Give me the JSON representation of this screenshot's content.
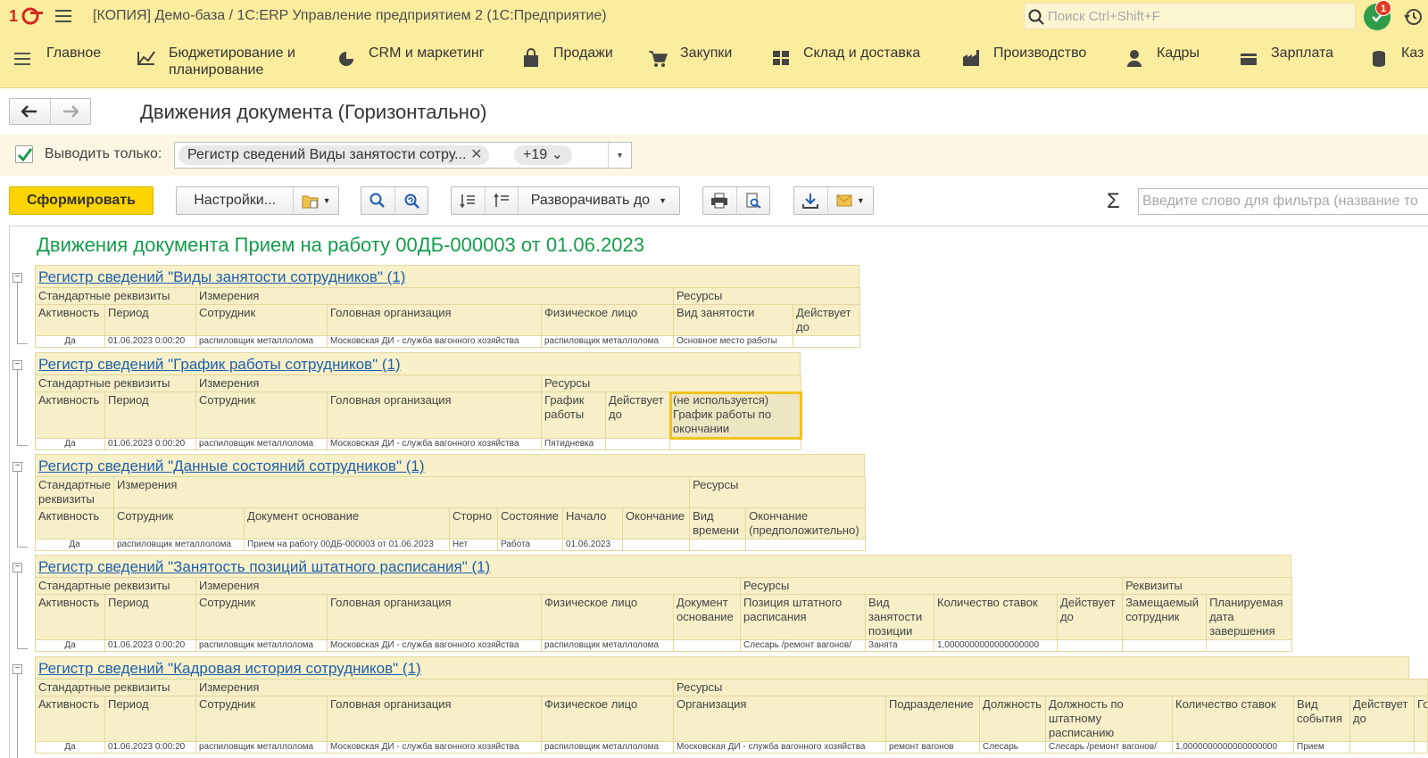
{
  "titlebar": {
    "title": "[КОПИЯ] Демо-база / 1С:ERP Управление предприятием 2  (1С:Предприятие)",
    "search_placeholder": "Поиск Ctrl+Shift+F",
    "notifications_count": "1"
  },
  "sections": [
    {
      "label": "Главное",
      "icon": "menu-icon"
    },
    {
      "label": "Бюджетирование и планирование",
      "icon": "budget-icon"
    },
    {
      "label": "CRM и маркетинг",
      "icon": "pie-chart-icon"
    },
    {
      "label": "Продажи",
      "icon": "shopping-bag-icon"
    },
    {
      "label": "Закупки",
      "icon": "cart-icon"
    },
    {
      "label": "Склад и доставка",
      "icon": "warehouse-icon"
    },
    {
      "label": "Производство",
      "icon": "factory-icon"
    },
    {
      "label": "Кадры",
      "icon": "person-icon"
    },
    {
      "label": "Зарплата",
      "icon": "wallet-icon"
    },
    {
      "label": "Каз",
      "icon": "coins-icon"
    }
  ],
  "form": {
    "title": "Движения документа (Горизонтально)",
    "filter_label": "Выводить только:",
    "filter_chip": "Регистр сведений Виды занятости сотру...",
    "filter_more": "+19",
    "generate_button": "Сформировать",
    "settings_button": "Настройки...",
    "expand_button": "Разворачивать до",
    "text_filter_placeholder": "Введите слово для фильтра (название то"
  },
  "report": {
    "title": "Движения документа Прием на работу 00ДБ-000003 от 01.06.2023",
    "blocks": [
      {
        "title": "Регистр сведений \"Виды занятости сотрудников\" (1)",
        "groups": [
          "Стандартные реквизиты",
          "Измерения",
          "Ресурсы"
        ],
        "columns": [
          "Активность",
          "Период",
          "Сотрудник",
          "Головная организация",
          "Физическое лицо",
          "Вид занятости",
          "Действует до"
        ],
        "row": [
          "Да",
          "01.06.2023 0:00:20",
          "распиловщик металлолома",
          "Московская ДИ - служба вагонного хозяйства",
          "распиловщик металлолома",
          "Основное место работы",
          ""
        ]
      },
      {
        "title": "Регистр сведений \"График работы сотрудников\" (1)",
        "groups": [
          "Стандартные реквизиты",
          "Измерения",
          "Ресурсы"
        ],
        "columns": [
          "Активность",
          "Период",
          "Сотрудник",
          "Головная организация",
          "График работы",
          "Действует до",
          "(не используется) График работы по окончании"
        ],
        "row": [
          "Да",
          "01.06.2023 0:00:20",
          "распиловщик металлолома",
          "Московская ДИ - служба вагонного хозяйства",
          "Пятидневка",
          "",
          ""
        ]
      },
      {
        "title": "Регистр сведений \"Данные состояний сотрудников\" (1)",
        "groups": [
          "Стандартные реквизиты",
          "Измерения",
          "Ресурсы"
        ],
        "columns": [
          "Активность",
          "Сотрудник",
          "Документ основание",
          "Сторно",
          "Состояние",
          "Начало",
          "Окончание",
          "Вид времени",
          "Окончание (предположительно)"
        ],
        "row": [
          "Да",
          "распиловщик металлолома",
          "Прием на работу 00ДБ-000003 от 01.06.2023",
          "Нет",
          "Работа",
          "01.06.2023",
          "",
          "",
          ""
        ]
      },
      {
        "title": "Регистр сведений \"Занятость позиций штатного расписания\" (1)",
        "groups": [
          "Стандартные реквизиты",
          "Измерения",
          "Ресурсы",
          "Реквизиты"
        ],
        "columns": [
          "Активность",
          "Период",
          "Сотрудник",
          "Головная организация",
          "Физическое лицо",
          "Документ основание",
          "Позиция штатного расписания",
          "Вид занятости позиции",
          "Количество ставок",
          "Действует до",
          "Замещаемый сотрудник",
          "Планируемая дата завершения"
        ],
        "row": [
          "Да",
          "01.06.2023 0:00:20",
          "распиловщик металлолома",
          "Московская ДИ - служба вагонного хозяйства",
          "распиловщик металлолома",
          "",
          "Слесарь /ремонт вагонов/",
          "Занята",
          "1,0000000000000000000",
          "",
          "",
          ""
        ]
      },
      {
        "title": "Регистр сведений \"Кадровая история сотрудников\" (1)",
        "groups": [
          "Стандартные реквизиты",
          "Измерения",
          "Ресурсы"
        ],
        "columns": [
          "Активность",
          "Период",
          "Сотрудник",
          "Головная организация",
          "Физическое лицо",
          "Организация",
          "Подразделение",
          "Должность",
          "Должность по штатному расписанию",
          "Количество ставок",
          "Вид события",
          "Действует до",
          "Го"
        ],
        "row": [
          "Да",
          "01.06.2023 0:00:20",
          "распиловщик металлолома",
          "Московская ДИ - служба вагонного хозяйства",
          "распиловщик металлолома",
          "Московская ДИ - служба вагонного хозяйства",
          "ремонт вагонов",
          "Слесарь",
          "Слесарь /ремонт вагонов/",
          "1,0000000000000000000",
          "Прием",
          "",
          ""
        ]
      }
    ]
  }
}
